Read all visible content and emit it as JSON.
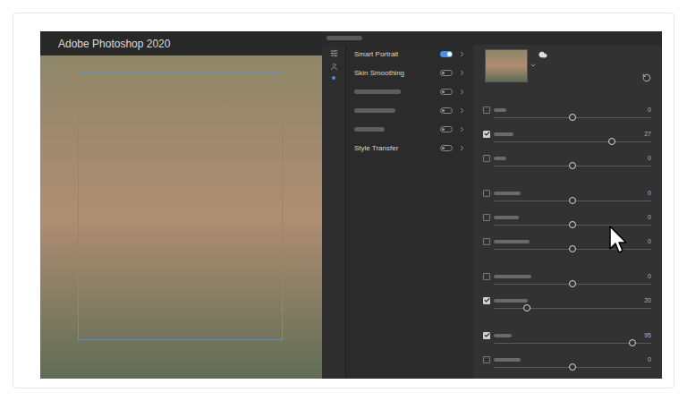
{
  "window": {
    "title": "Adobe Photoshop 2020"
  },
  "filters": [
    {
      "kind": "label",
      "label": "Smart Portrait",
      "on": true
    },
    {
      "kind": "label",
      "label": "Skin Smoothing",
      "on": false
    },
    {
      "kind": "placeholder",
      "on": false
    },
    {
      "kind": "placeholder",
      "on": false
    },
    {
      "kind": "placeholder",
      "on": false
    },
    {
      "kind": "label",
      "label": "Style Transfer",
      "on": false
    }
  ],
  "slider_groups": [
    [
      {
        "checked": false,
        "level": 0.5,
        "value": "0"
      },
      {
        "checked": true,
        "level": 0.75,
        "value": "27"
      },
      {
        "checked": false,
        "level": 0.5,
        "value": "0"
      }
    ],
    [
      {
        "checked": false,
        "level": 0.5,
        "value": "0"
      },
      {
        "checked": false,
        "level": 0.5,
        "value": "0"
      },
      {
        "checked": false,
        "level": 0.5,
        "value": "0"
      }
    ],
    [
      {
        "checked": false,
        "level": 0.5,
        "value": "0"
      },
      {
        "checked": true,
        "level": 0.21,
        "value": "20"
      }
    ],
    [
      {
        "checked": true,
        "level": 0.88,
        "value": "95"
      },
      {
        "checked": false,
        "level": 0.5,
        "value": "0"
      }
    ]
  ]
}
